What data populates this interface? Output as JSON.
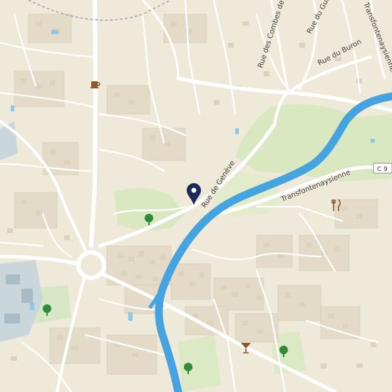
{
  "map": {
    "streets": {
      "rue_de_geneve": "Rue de Genève",
      "rue_des_combes": "Rue des Combes de S",
      "rue_du_gue": "Rue du Gue",
      "rue_du_buron": "Rue du Buron",
      "transfontenaysienne_upper": "Transfontenaysienne",
      "transfontenaysienne_lower": "Transfontenaysienne"
    },
    "road_shield": "C 9"
  },
  "colors": {
    "background": "#efe9d9",
    "river": "#45a3e0",
    "park": "#d9e8c1",
    "marker": "#1a2b58",
    "tree": "#2f8a3a",
    "road": "#ffffff",
    "building": "#dcd2bf"
  },
  "icons": [
    "map-marker-icon",
    "cafe-icon",
    "restaurant-icon",
    "bar-icon",
    "tree-icon"
  ]
}
